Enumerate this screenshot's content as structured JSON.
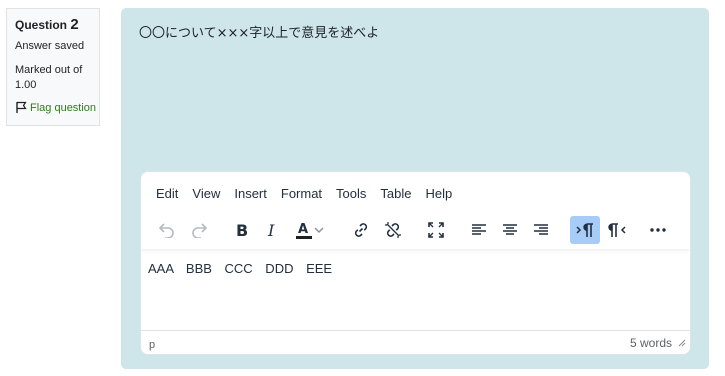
{
  "question_info": {
    "label": "Question",
    "number": "2",
    "state": "Answer saved",
    "grade": "Marked out of 1.00",
    "flag_label": "Flag question",
    "flag_color": "#2f7a1d"
  },
  "question": {
    "text": "〇〇について×××字以上で意見を述べよ",
    "background": "#cee5ea"
  },
  "editor": {
    "menus": [
      "Edit",
      "View",
      "Insert",
      "Format",
      "Tools",
      "Table",
      "Help"
    ],
    "toolbar": [
      "undo-icon",
      "redo-icon",
      "bold-icon",
      "italic-icon",
      "text-color-icon",
      "chevron-down-icon",
      "link-icon",
      "unlink-icon",
      "fullscreen-icon",
      "align-left-icon",
      "align-center-icon",
      "align-right-icon",
      "ltr-icon",
      "rtl-icon",
      "more-icon"
    ],
    "active_button": "ltr-icon",
    "active_color": "#a6ccf7",
    "text_color_swatch": "#1d2125",
    "content": "AAA BBB CCC DDD EEE",
    "status_path": "p",
    "word_count": "5 words"
  }
}
